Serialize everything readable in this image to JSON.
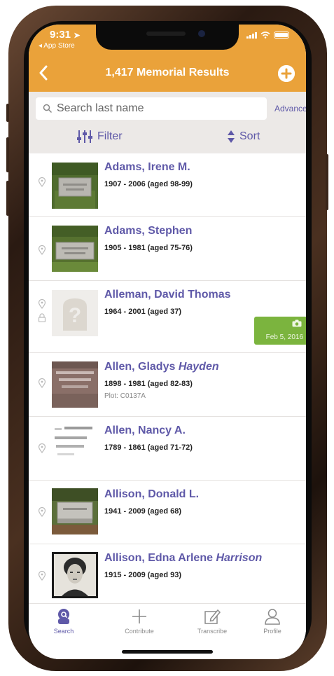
{
  "status_bar": {
    "time": "9:31",
    "back_to_app": "◂ App Store"
  },
  "header": {
    "title": "1,417 Memorial Results",
    "back_icon": "chevron-left-icon",
    "add_icon": "plus-circle-icon"
  },
  "search": {
    "placeholder": "Search last name",
    "advanced_label": "Advanced"
  },
  "toolbar": {
    "filter_label": "Filter",
    "sort_label": "Sort"
  },
  "results": [
    {
      "name": "Adams, Irene M.",
      "name_italic": "",
      "dates": "1907 - 2006 (aged 98-99)",
      "plot": "",
      "thumb": "headstone-photo"
    },
    {
      "name": "Adams, Stephen",
      "name_italic": "",
      "dates": "1905 - 1981 (aged 75-76)",
      "plot": "",
      "thumb": "headstone-photo"
    },
    {
      "name": "Alleman, David Thomas",
      "name_italic": "",
      "dates": "1964 - 2001 (aged 37)",
      "plot": "",
      "thumb": "no-photo-placeholder",
      "photo_request_date": "Feb 5, 2016"
    },
    {
      "name": "Allen, Gladys ",
      "name_italic": "Hayden",
      "dates": "1898 - 1981 (aged 82-83)",
      "plot": "Plot: C0137A",
      "thumb": "engraved-stone-photo"
    },
    {
      "name": "Allen, Nancy A.",
      "name_italic": "",
      "dates": "1789 - 1861 (aged 71-72)",
      "plot": "",
      "thumb": "inscription-photo"
    },
    {
      "name": "Allison, Donald L.",
      "name_italic": "",
      "dates": "1941 - 2009 (aged 68)",
      "plot": "",
      "thumb": "headstone-photo"
    },
    {
      "name": "Allison, Edna Arlene ",
      "name_italic": "Harrison",
      "dates": "1915 - 2009 (aged 93)",
      "plot": "",
      "thumb": "portrait-photo"
    }
  ],
  "tabs": [
    {
      "label": "Search",
      "icon": "search-person-icon",
      "active": true
    },
    {
      "label": "Contribute",
      "icon": "plus-icon",
      "active": false
    },
    {
      "label": "Transcribe",
      "icon": "edit-icon",
      "active": false
    },
    {
      "label": "Profile",
      "icon": "person-icon",
      "active": false
    }
  ],
  "colors": {
    "header": "#eaa23a",
    "accent": "#5f59a8",
    "photo_badge": "#7bb43e",
    "search_bar_bg": "#ece9e7"
  }
}
